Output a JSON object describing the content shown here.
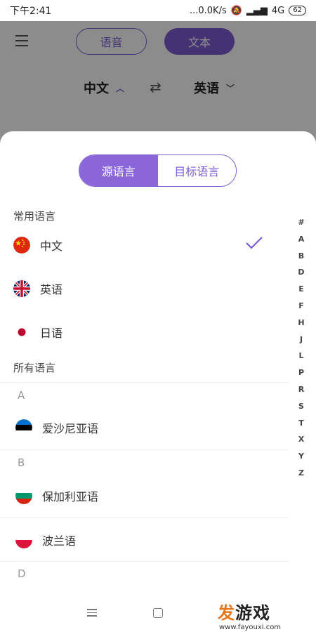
{
  "status_bar": {
    "time": "下午2:41",
    "network": "...0.0K/s",
    "signal": "4G",
    "battery": "62"
  },
  "app": {
    "mode_voice": "语音",
    "mode_text": "文本",
    "source_lang": "中文",
    "target_lang": "英语"
  },
  "sheet": {
    "toggle_source": "源语言",
    "toggle_target": "目标语言",
    "common_label": "常用语言",
    "all_label": "所有语言",
    "common_languages": [
      {
        "name": "中文",
        "flag": "china-flag",
        "selected": true
      },
      {
        "name": "英语",
        "flag": "uk-flag",
        "selected": false
      },
      {
        "name": "日语",
        "flag": "japan-flag",
        "selected": false
      }
    ],
    "groups": [
      {
        "letter": "A",
        "items": [
          {
            "name": "爱沙尼亚语",
            "flag": "estonia-flag"
          }
        ]
      },
      {
        "letter": "B",
        "items": [
          {
            "name": "保加利亚语",
            "flag": "bulgaria-flag"
          },
          {
            "name": "波兰语",
            "flag": "poland-flag"
          }
        ]
      },
      {
        "letter": "D",
        "items": []
      }
    ],
    "index": [
      "#",
      "A",
      "B",
      "D",
      "E",
      "F",
      "H",
      "J",
      "L",
      "P",
      "R",
      "S",
      "T",
      "X",
      "Y",
      "Z"
    ]
  },
  "watermark": {
    "brand_a": "发",
    "brand_b": "游戏",
    "url": "www.fayouxi.com"
  },
  "colors": {
    "accent": "#7c5cd6"
  }
}
